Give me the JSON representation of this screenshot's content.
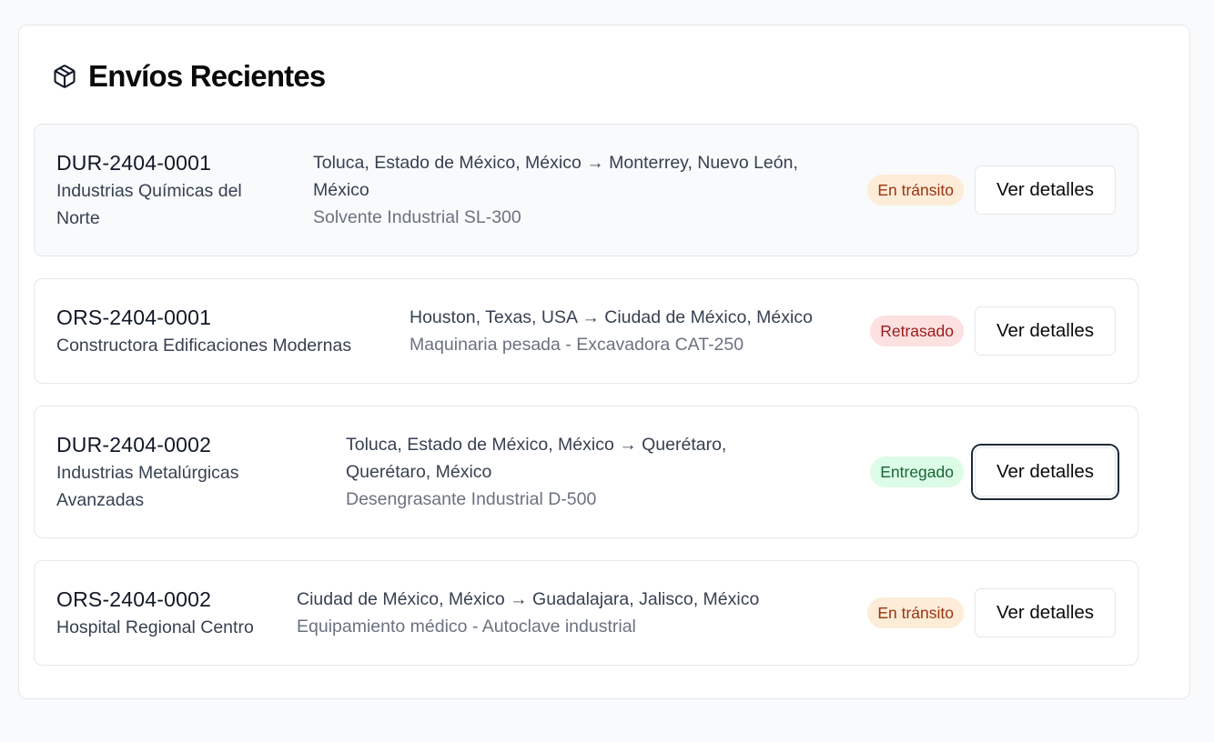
{
  "header": {
    "title": "Envíos Recientes",
    "icon": "package-icon"
  },
  "shipments": [
    {
      "id": "DUR-2404-0001",
      "company_line1": "Industrias Químicas del",
      "company_line2": "Norte",
      "route_line1": "Toluca, Estado de México, México → Monterrey, Nuevo León,",
      "route_line2": "México",
      "product": "Solvente Industrial SL-300",
      "status": "En tránsito",
      "status_color": "#9a3412",
      "action": "Ver detalles"
    },
    {
      "id": "ORS-2404-0001",
      "company_line1": "Constructora Edificaciones Modernas",
      "route_line1": "Houston, Texas, USA → Ciudad de México, México",
      "product": "Maquinaria pesada - Excavadora CAT-250",
      "status": "Retrasado",
      "status_color": "#991b1b",
      "action": "Ver detalles"
    },
    {
      "id": "DUR-2404-0002",
      "company_line1": "Industrias Metalúrgicas",
      "company_line2": "Avanzadas",
      "route_line1": "Toluca, Estado de México, México → Querétaro,",
      "route_line2": "Querétaro, México",
      "product": "Desengrasante Industrial D-500",
      "status": "Entregado",
      "status_color": "#166534",
      "action": "Ver detalles"
    },
    {
      "id": "ORS-2404-0002",
      "company_line1": "Hospital Regional Centro",
      "route_line1": "Ciudad de México, México → Guadalajara, Jalisco, México",
      "product": "Equipamiento médico - Autoclave industrial",
      "status": "En tránsito",
      "status_color": "#9a3412",
      "action": "Ver detalles"
    }
  ]
}
